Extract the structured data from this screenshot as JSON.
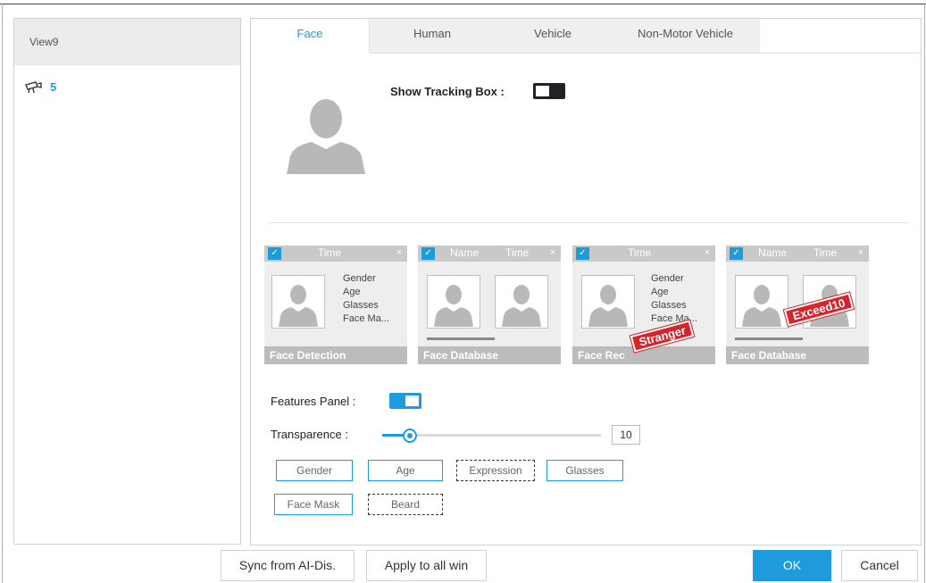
{
  "left": {
    "view_title": "View9",
    "camera_count": "5"
  },
  "tabs": [
    {
      "label": "Face",
      "active": true
    },
    {
      "label": "Human",
      "active": false
    },
    {
      "label": "Vehicle",
      "active": false
    },
    {
      "label": "Non-Motor Vehicle",
      "active": false
    }
  ],
  "show_tracking_box": {
    "label": "Show Tracking Box :",
    "on": false
  },
  "cards": [
    {
      "headers": [
        "Time"
      ],
      "features": [
        "Gender",
        "Age",
        "Glasses",
        "Face Ma..."
      ],
      "footer": "Face Detection",
      "stamp": ""
    },
    {
      "headers": [
        "Name",
        "Time"
      ],
      "features": [],
      "footer": "Face Database",
      "stamp": ""
    },
    {
      "headers": [
        "Time"
      ],
      "features": [
        "Gender",
        "Age",
        "Glasses",
        "Face Ma..."
      ],
      "footer": "Face Rec",
      "stamp": "Stranger"
    },
    {
      "headers": [
        "Name",
        "Time"
      ],
      "features": [],
      "footer": "Face Database",
      "stamp": "Exceed10"
    }
  ],
  "features_panel": {
    "label": "Features Panel :",
    "on": true
  },
  "transparence": {
    "label": "Transparence :",
    "value": "10",
    "level": 0.1
  },
  "chips": [
    {
      "label": "Gender",
      "selected": true
    },
    {
      "label": "Age",
      "selected": true
    },
    {
      "label": "Expression",
      "selected": false
    },
    {
      "label": "Glasses",
      "selected": true
    },
    {
      "label": "Face Mask",
      "selected": true
    },
    {
      "label": "Beard",
      "selected": false
    }
  ],
  "buttons": {
    "sync": "Sync from AI-Dis.",
    "apply_all": "Apply to all win",
    "ok": "OK",
    "cancel": "Cancel"
  },
  "colors": {
    "accent": "#1e9bdc",
    "stamp": "#d8232a"
  }
}
